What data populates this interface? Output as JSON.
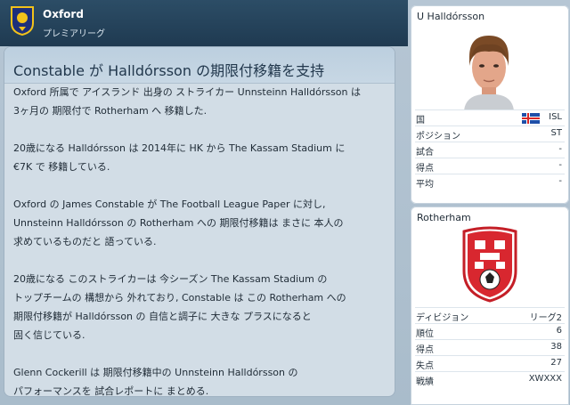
{
  "header": {
    "club_name": "Oxford",
    "league_name": "プレミアリーグ"
  },
  "news": {
    "title": "Constable が Halldórsson の期限付移籍を支持",
    "paragraphs": [
      [
        "Oxford 所属で アイスランド 出身の ストライカー Unnsteinn Halldórsson は",
        "3ヶ月の 期限付で Rotherham へ 移籍した."
      ],
      [
        "20歳になる Halldórsson は 2014年に HK から The Kassam Stadium に",
        "€7K で 移籍している."
      ],
      [
        "Oxford の James Constable が The Football League Paper に対し,",
        "Unnsteinn Halldórsson の Rotherham への 期限付移籍は まさに 本人の",
        "求めているものだと 語っている."
      ],
      [
        "20歳になる このストライカーは 今シーズン The Kassam Stadium の",
        "トップチームの 構想から 外れており, Constable は この Rotherham への",
        "期限付移籍が Halldórsson の 自信と調子に 大きな プラスになると",
        "固く信じている."
      ],
      [
        "Glenn Cockerill は 期限付移籍中の Unnsteinn Halldórsson の",
        "パフォーマンスを 試合レポートに まとめる."
      ]
    ]
  },
  "player": {
    "name": "U Halldórsson",
    "portrait_icon": "player-portrait-icon",
    "stats": [
      {
        "label": "国",
        "value": "ISL"
      },
      {
        "label": "ポジション",
        "value": "ST"
      },
      {
        "label": "試合",
        "value": "-"
      },
      {
        "label": "得点",
        "value": "-"
      },
      {
        "label": "平均",
        "value": "-"
      }
    ]
  },
  "club": {
    "name": "Rotherham",
    "stats": [
      {
        "label": "ディビジョン",
        "value": "リーグ2"
      },
      {
        "label": "順位",
        "value": "6"
      },
      {
        "label": "得点",
        "value": "38"
      },
      {
        "label": "失点",
        "value": "27"
      },
      {
        "label": "戦績",
        "value": "XWXXX"
      }
    ]
  },
  "colors": {
    "header_bg": "#1f3a51",
    "panel_bg": "#d2dde6",
    "badge_red": "#d8272f"
  }
}
